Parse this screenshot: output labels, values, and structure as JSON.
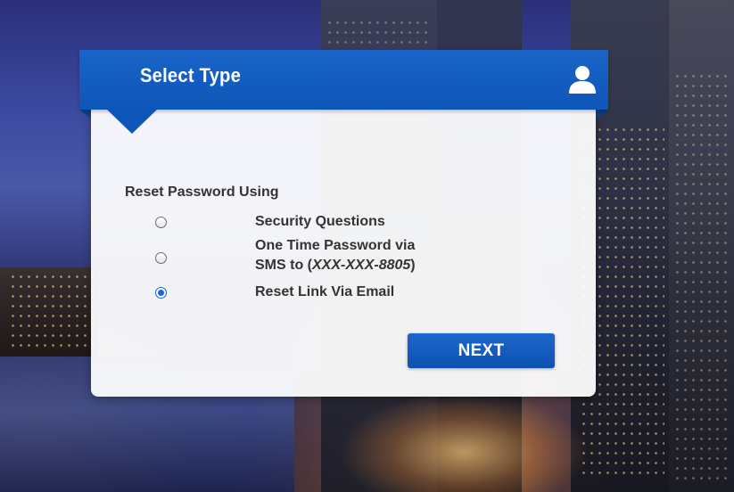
{
  "header": {
    "title": "Select Type",
    "icon": "user-icon"
  },
  "form": {
    "section_label": "Reset Password Using",
    "options": [
      {
        "label": "Security Questions",
        "selected": false
      },
      {
        "label_line1": "One Time Password via",
        "label_line2_prefix": "SMS to (",
        "label_line2_masked": "XXX-XXX-8805",
        "label_line2_suffix": ")",
        "selected": false
      },
      {
        "label": "Reset Link Via Email",
        "selected": true
      }
    ],
    "next_label": "NEXT"
  },
  "colors": {
    "accent": "#0e56b8",
    "radio_selected": "#1a66d2",
    "text": "#333333"
  }
}
